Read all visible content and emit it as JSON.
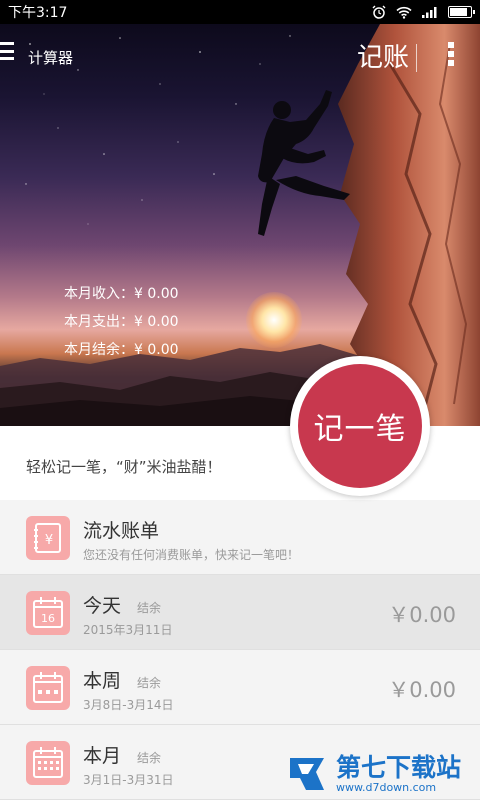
{
  "status_bar": {
    "time": "下午3:17"
  },
  "header": {
    "calculator_label": "计算器",
    "title": "记账"
  },
  "summary": [
    {
      "label": "本月收入：",
      "value": "¥ 0.00"
    },
    {
      "label": "本月支出：",
      "value": "¥ 0.00"
    },
    {
      "label": "本月结余：",
      "value": "¥ 0.00"
    }
  ],
  "record_button": {
    "label": "记一笔"
  },
  "slogan": "轻松记一笔，“财”米油盐醋！",
  "list": [
    {
      "name": "流水账单",
      "sub": "您还没有任何消费账单，快来记一笔吧！",
      "icon": "bill-icon"
    },
    {
      "name": "今天",
      "tag": "结余",
      "sub": "2015年3月11日",
      "amount": "￥0.00",
      "icon": "calendar-day-icon",
      "icon_text": "16"
    },
    {
      "name": "本周",
      "tag": "结余",
      "sub": "3月8日-3月14日",
      "amount": "￥0.00",
      "icon": "calendar-week-icon"
    },
    {
      "name": "本月",
      "tag": "结余",
      "sub": "3月1日-3月31日",
      "amount": "",
      "icon": "calendar-month-icon"
    }
  ],
  "watermark": {
    "name": "第七下载站",
    "url": "www.d7down.com"
  },
  "colors": {
    "accent": "#c8384e",
    "icon_bg": "#f7a9a9",
    "watermark": "#1c73c8"
  }
}
